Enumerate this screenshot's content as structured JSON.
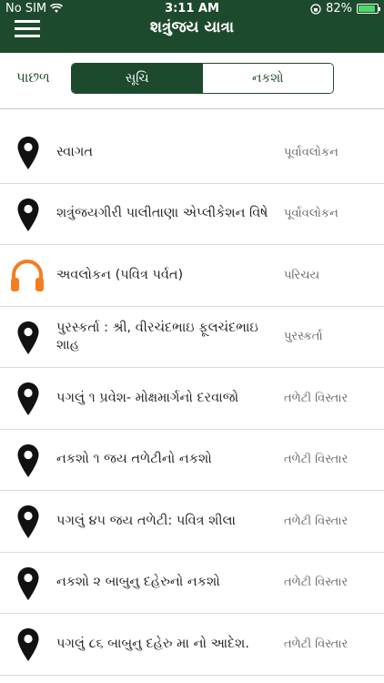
{
  "status_bar": {
    "carrier": "No SIM",
    "time": "3:11 AM",
    "battery": "82%"
  },
  "header": {
    "title": "શત્રુંજય યાત્રા"
  },
  "toolbar": {
    "back_label": "પાછળ",
    "segments": [
      {
        "label": "સૂચિ"
      },
      {
        "label": "નકશો"
      }
    ]
  },
  "list": {
    "items": [
      {
        "title": "સ્વાગત",
        "category": "પૂર્વાવલોકન",
        "icon": "map-pin-icon"
      },
      {
        "title": "શત્રુંજયગીરી પાલીતાણા એપ્લીકેશન વિષે",
        "category": "પૂર્વાવલોકન",
        "icon": "map-pin-icon"
      },
      {
        "title": "અવલોકન (પવિત્ર પર્વત)",
        "category": "પરિચય",
        "icon": "headphones-icon"
      },
      {
        "title": "પુરસ્કર્તા : શ્રી, વીરચંદભાઇ ફૂલચંદભાઇ શાહ",
        "category": "પુરસ્કર્તા",
        "icon": "map-pin-icon"
      },
      {
        "title": "પગલું ૧ પ્રવેશ- મોક્ષમાર્ગનો દરવાજો",
        "category": "તળેટી વિસ્તાર",
        "icon": "map-pin-icon"
      },
      {
        "title": "નકશો ૧ જય તળેટીનો નકશો",
        "category": "તળેટી વિસ્તાર",
        "icon": "map-pin-icon"
      },
      {
        "title": "પગલું ૪૫ જય તળેટી: પવિત્ર શીલા",
        "category": "તળેટી વિસ્તાર",
        "icon": "map-pin-icon"
      },
      {
        "title": "નકશો ૨ બાબુનુ દહેરુનો નકશો",
        "category": "તળેટી વિસ્તાર",
        "icon": "map-pin-icon"
      },
      {
        "title": "પગલું ૮૬ બાબુનુ દહેરુ મા નો આદેશ.",
        "category": "તળેટી વિસ્તાર",
        "icon": "map-pin-icon"
      }
    ]
  },
  "colors": {
    "header_bg": "#1d4a2c",
    "accent": "#1d4a2c",
    "headphones": "#f57c1f"
  }
}
